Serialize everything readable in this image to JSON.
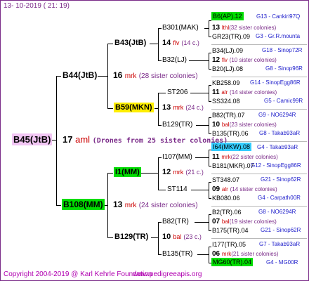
{
  "header": {
    "date": "13-  10-2019  (  21:  19)"
  },
  "footer": {
    "copyright": "Copyright 2004-2019 @ Karl Kehrle Foundation",
    "url": "www.pedigreeapis.org"
  },
  "root": {
    "name": "B45(JtB)",
    "num": "17",
    "code": "aml",
    "note": "(Drones from 25 sister colonies)"
  },
  "g2": [
    {
      "name": "B44(JtB)",
      "num": "16",
      "code": "mrk",
      "note": "(28 sister colonies)"
    },
    {
      "name": "B108(MM)",
      "num": "13",
      "code": "mrk",
      "note": "(24 sister colonies)"
    }
  ],
  "g3": [
    {
      "name": "B43(JtB)",
      "num": "14",
      "code": "flv",
      "note": "(14 c.)"
    },
    {
      "name": "B59(MKN)",
      "num": "13",
      "code": "mrk",
      "note": "(24 c.)"
    },
    {
      "name": "I1(MM)",
      "num": "12",
      "code": "mrk",
      "note": "(21 c.)"
    },
    {
      "name": "B129(TR)",
      "num": "10",
      "code": "bal",
      "note": "(23 c.)"
    }
  ],
  "g4": [
    {
      "name": "B301(MAK)",
      "num": "13",
      "code": "lthl",
      "note": "(32 sister colonies)"
    },
    {
      "name": "B32(LJ)",
      "num": "12",
      "code": "flv",
      "note": "(10 sister colonies)"
    },
    {
      "name": "ST206",
      "num": "11",
      "code": "alr",
      "note": "(14 sister colonies)"
    },
    {
      "name": "B129(TR)",
      "num": "10",
      "code": "bal",
      "note": "(23 sister colonies)"
    },
    {
      "name": "I107(MM)",
      "num": "11",
      "code": "mrk",
      "note": "(22 sister colonies)"
    },
    {
      "name": "ST114",
      "num": "09",
      "code": "alr",
      "note": "(14 sister colonies)"
    },
    {
      "name": "B82(TR)",
      "num": "07",
      "code": "bal",
      "note": "(19 sister colonies)"
    },
    {
      "name": "B135(TR)",
      "num": "06",
      "code": "mrk",
      "note": "(21 sister colonies)"
    }
  ],
  "g5": [
    {
      "name": "B6(AP).12",
      "loc": "G13 - Cankiri97Q"
    },
    {
      "name": "GR23(TR).09",
      "loc": "G3 - Gr.R.mounta"
    },
    {
      "name": "B34(LJ).09",
      "loc": "G18 - Sinop72R"
    },
    {
      "name": "B20(LJ).08",
      "loc": "G8 - Sinop96R"
    },
    {
      "name": "KB258.09",
      "loc": "G14 - SinopEgg86R"
    },
    {
      "name": "SS324.08",
      "loc": "G5 - Camic99R"
    },
    {
      "name": "B82(TR).07",
      "loc": "G9 - NO6294R"
    },
    {
      "name": "B135(TR).06",
      "loc": "G8 - Takab93aR"
    },
    {
      "name": "I64(MKW).08",
      "loc": "G4 - Takab93aR"
    },
    {
      "name": "B181(MKR).07",
      "loc": "G12 - SinopEgg86R"
    },
    {
      "name": "ST348.07",
      "loc": "G21 - Sinop62R"
    },
    {
      "name": "KB080.06",
      "loc": "G4 - Carpath00R"
    },
    {
      "name": "B2(TR).06",
      "loc": "G8 - NO6294R"
    },
    {
      "name": "B175(TR).04",
      "loc": "G21 - Sinop62R"
    },
    {
      "name": "I177(TR).05",
      "loc": "G7 - Takab93aR"
    },
    {
      "name": "MG60(TR).04",
      "loc": "G4 - MG00R"
    }
  ]
}
